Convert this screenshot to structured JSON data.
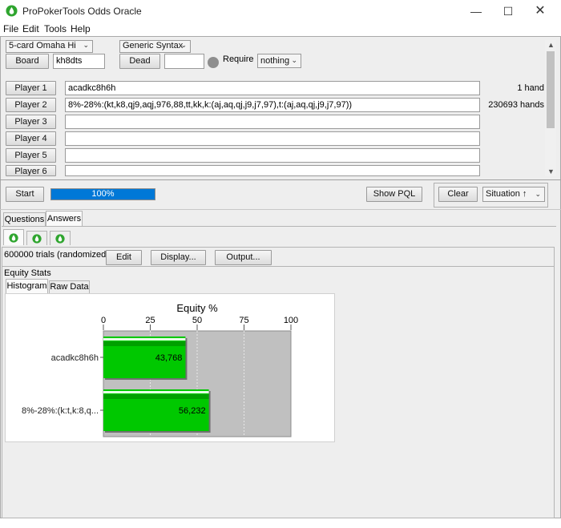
{
  "window": {
    "title": "ProPokerTools Odds Oracle",
    "icon": "droplet-icon",
    "controls": [
      "minimize-icon",
      "maximize-icon",
      "close-icon"
    ]
  },
  "menu": [
    "File",
    "Edit",
    "Tools",
    "Help"
  ],
  "setup": {
    "game": "5-card Omaha Hi",
    "syntax": "Generic Syntax",
    "board_label": "Board",
    "board_value": "kh8dts",
    "dead_label": "Dead",
    "dead_value": "",
    "require_label": "Require",
    "require_value": "nothing"
  },
  "players": [
    {
      "label": "Player 1",
      "range": "acadkc8h6h",
      "count": "1 hand"
    },
    {
      "label": "Player 2",
      "range": "8%-28%:(kt,k8,qj9,aqj,976,88,tt,kk,k:(aj,aq,qj,j9,j7,97),t:(aj,aq,qj,j9,j7,97))",
      "count": "230693 hands"
    },
    {
      "label": "Player 3",
      "range": "",
      "count": ""
    },
    {
      "label": "Player 4",
      "range": "",
      "count": ""
    },
    {
      "label": "Player 5",
      "range": "",
      "count": ""
    },
    {
      "label": "Player 6",
      "range": "",
      "count": ""
    }
  ],
  "controls": {
    "start_label": "Start",
    "progress_text": "100%",
    "progress_value": 1.0,
    "show_pql_label": "Show PQL",
    "clear_label": "Clear",
    "situation_label": "Situation ↑"
  },
  "tabs": {
    "questions": "Questions",
    "answers": "Answers"
  },
  "answers": {
    "trials": "600000 trials (randomized)",
    "edit_label": "Edit",
    "display_label": "Display...",
    "output_label": "Output...",
    "stats_title": "Equity Stats",
    "sub_tabs": [
      "Histogram",
      "Raw Data"
    ]
  },
  "chart_data": {
    "type": "bar",
    "orientation": "horizontal",
    "title": "Equity %",
    "categories": [
      "acadkc8h6h",
      "8%-28%:(k:t,k:8,q..."
    ],
    "values": [
      43.768,
      56.232
    ],
    "data_labels": [
      "43,768",
      "56,232"
    ],
    "xlim": [
      0,
      100
    ],
    "ticks": [
      "0",
      "25",
      "50",
      "75",
      "100"
    ],
    "bar_color": "#00c800",
    "plot_bg": "#c0c0c0"
  },
  "colors": {
    "accent": "#0078d7",
    "bar": "#00c800"
  }
}
